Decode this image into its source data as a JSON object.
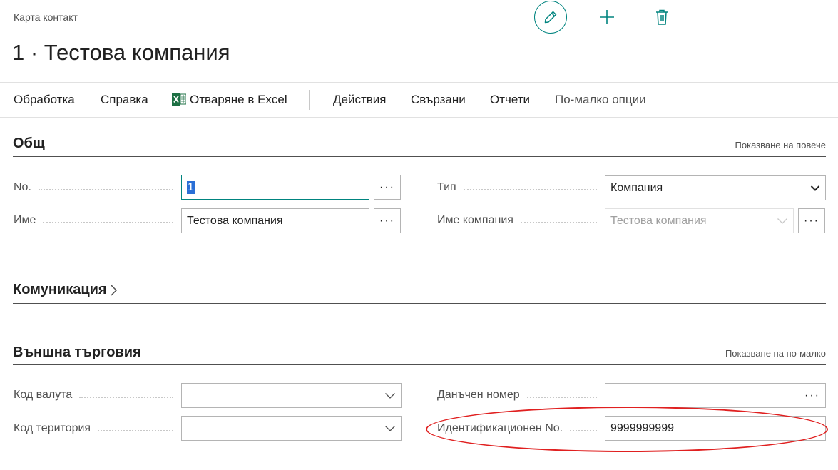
{
  "header": {
    "breadcrumb": "Карта контакт",
    "title": "1 · Тестова компания",
    "buttons": {
      "edit": "pencil-icon",
      "add": "plus-icon",
      "delete": "trash-icon"
    }
  },
  "actions": {
    "items": [
      "Обработка",
      "Справка",
      "Отваряне в Excel",
      "Действия",
      "Свързани",
      "Отчети",
      "По-малко опции"
    ],
    "accent": "#00847f"
  },
  "general": {
    "title": "Общ",
    "toggle": "Показване на повече",
    "no_label": "No.",
    "no_value": "1",
    "name_label": "Име",
    "name_value": "Тестова компания",
    "type_label": "Тип",
    "type_value": "Компания",
    "company_label": "Име компания",
    "company_value": "Тестова компания",
    "assist": "···"
  },
  "communication": {
    "title": "Комуникация"
  },
  "foreign_trade": {
    "title": "Външна търговия",
    "toggle": "Показване на по-малко",
    "currency_label": "Код валута",
    "currency_value": "",
    "territory_label": "Код територия",
    "territory_value": "",
    "vat_label": "Данъчен номер",
    "vat_value": "",
    "id_label": "Идентификационен No.",
    "id_value": "9999999999"
  }
}
